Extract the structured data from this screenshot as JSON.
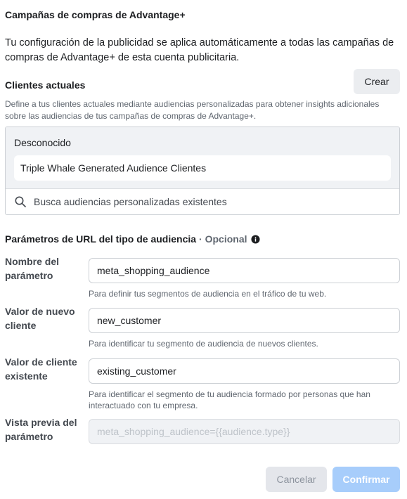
{
  "header": {
    "title": "Campañas de compras de Advantage+",
    "intro": "Tu configuración de la publicidad se aplica automáticamente a todas las campañas de compras de Advantage+ de esta cuenta publicitaria."
  },
  "clients": {
    "title": "Clientes actuales",
    "create_label": "Crear",
    "description": "Define a tus clientes actuales mediante audiencias personalizadas para obtener insights adicionales sobre las audiencias de tus campañas de compras de Advantage+.",
    "group_label": "Desconocido",
    "selected_audience": "Triple Whale Generated Audience Clientes",
    "search_placeholder": "Busca audiencias personalizadas existentes",
    "search_icon": "search-icon"
  },
  "url_params": {
    "title": "Parámetros de URL del tipo de audiencia",
    "optional": "· Opcional",
    "info_icon": "info-icon",
    "fields": [
      {
        "label": "Nombre del parámetro",
        "value": "meta_shopping_audience",
        "help": "Para definir tus segmentos de audiencia en el tráfico de tu web."
      },
      {
        "label": "Valor de nuevo cliente",
        "value": "new_customer",
        "help": "Para identificar tu segmento de audiencia de nuevos clientes."
      },
      {
        "label": "Valor de cliente existente",
        "value": "existing_customer",
        "help": "Para identificar el segmento de tu audiencia formado por personas que han interactuado con tu empresa."
      },
      {
        "label": "Vista previa del parámetro",
        "value": "meta_shopping_audience={{audience.type}}"
      }
    ]
  },
  "footer": {
    "cancel_label": "Cancelar",
    "confirm_label": "Confirmar"
  },
  "colors": {
    "confirm_disabled": "#a7cdfb",
    "secondary_button": "#e4e6eb"
  }
}
